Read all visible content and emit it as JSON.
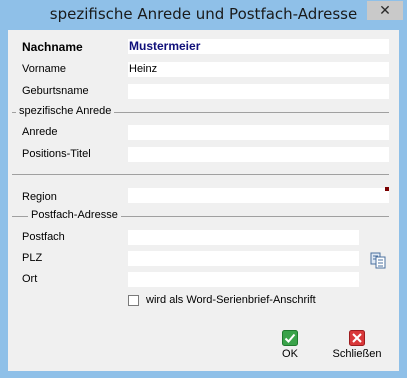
{
  "window": {
    "title": "spezifische Anrede und Postfach-Adresse",
    "close_glyph": "✕"
  },
  "fields": {
    "nachname": {
      "label": "Nachname",
      "value": "Mustermeier"
    },
    "vorname": {
      "label": "Vorname",
      "value": "Heinz"
    },
    "geburtsname": {
      "label": "Geburtsname",
      "value": ""
    },
    "anrede": {
      "label": "Anrede",
      "value": ""
    },
    "positions_titel": {
      "label": "Positions-Titel",
      "value": ""
    },
    "region": {
      "label": "Region",
      "value": ""
    },
    "postfach": {
      "label": "Postfach",
      "value": ""
    },
    "plz": {
      "label": "PLZ",
      "value": ""
    },
    "ort": {
      "label": "Ort",
      "value": ""
    }
  },
  "sections": {
    "anrede": "spezifische Anrede",
    "postfach": "Postfach-Adresse"
  },
  "checkbox": {
    "label": "wird als Word-Serienbrief-Anschrift",
    "checked": false
  },
  "buttons": {
    "ok": "OK",
    "close": "Schließen"
  },
  "icons": {
    "copy": "copy-icon",
    "ok": "checkmark-icon",
    "close": "close-x-icon"
  },
  "colors": {
    "titlebar": "#8fc0e8",
    "ok_green": "#3aa34a",
    "close_red": "#d9383a",
    "bold_text": "#10107a"
  }
}
